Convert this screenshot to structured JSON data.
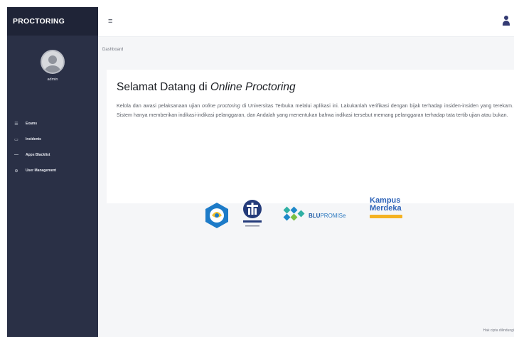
{
  "app": {
    "brand": "PROCTORING"
  },
  "sidebar": {
    "username": "admin",
    "items": [
      {
        "icon": "exam-icon",
        "label": "Exams"
      },
      {
        "icon": "incident-icon",
        "label": "Incidents"
      },
      {
        "icon": "blacklist-icon",
        "label": "Apps Blacklist"
      },
      {
        "icon": "user-management-icon",
        "label": "User Management"
      }
    ]
  },
  "header": {
    "menu_icon": "hamburger-icon",
    "user_icon": "user-icon"
  },
  "breadcrumb": "Dashboard",
  "welcome": {
    "title_prefix": "Selamat Datang di ",
    "title_emphasis": "Online Proctoring",
    "para_1": "Kelola dan awasi pelaksanaan ujian ",
    "para_em": "online proctoring",
    "para_2": " di Universitas Terbuka melalui aplikasi ini. Lakukanlah verifikasi dengan bijak terhadap insiden-insiden yang terekam. Sistem hanya memberikan indikasi-indikasi pelanggaran, dan Andalah yang menentukan bahwa indikasi tersebut memang pelanggaran terhadap tata tertib ujian atau bukan."
  },
  "logos": {
    "blu_label": "BLU",
    "blu_suffix": "PROMISe",
    "kampus_line1": "Kampus",
    "kampus_line2": "Merdeka"
  },
  "footer": "Hak cipta dilindungi",
  "colors": {
    "sidebar": "#2a3046",
    "brand_bar": "#1f2437",
    "content_bg": "#f5f6f8",
    "accent": "#343b73"
  }
}
